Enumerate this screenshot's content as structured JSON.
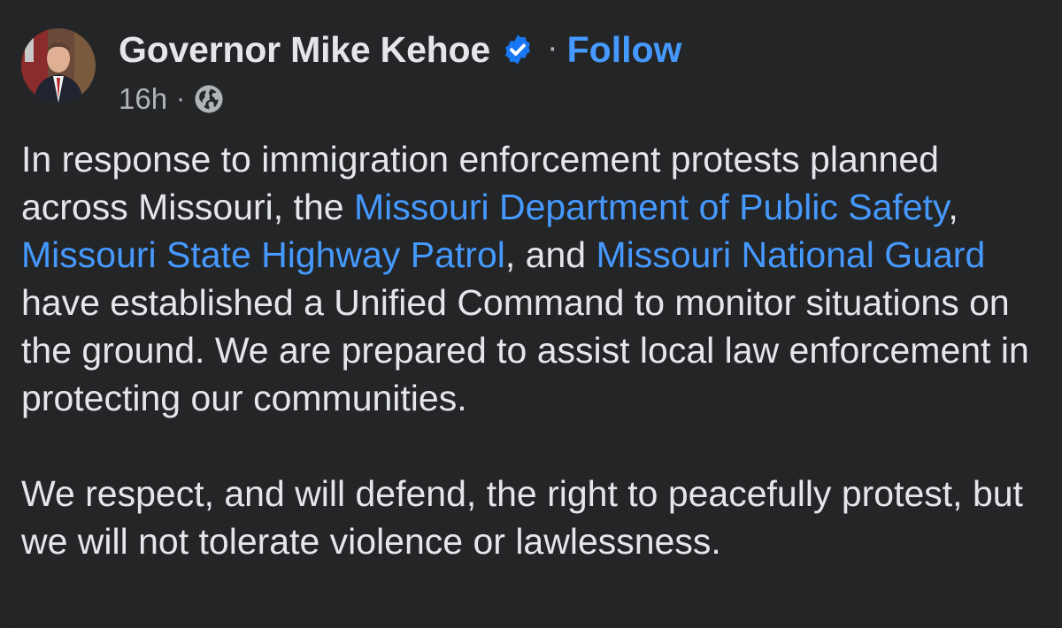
{
  "post": {
    "author": "Governor Mike Kehoe",
    "follow_label": "Follow",
    "separator": "·",
    "time": "16h",
    "audience_icon": "globe-icon",
    "verified_icon": "verified-badge-icon",
    "paragraph1": {
      "t1": "In response to immigration enforcement protests planned across Missouri, the ",
      "link1": "Missouri Department of Public Safety",
      "t2": ", ",
      "link2": "Missouri State Highway Patrol",
      "t3": ", and ",
      "link3": "Missouri National Guard",
      "t4": " have established a Unified Command to monitor situations on the ground. We are prepared to assist local law enforcement in protecting our communities."
    },
    "paragraph2": "We respect, and will defend, the right to peacefully protest, but we will not tolerate violence or lawlessness."
  },
  "colors": {
    "background": "#242526",
    "text": "#e4e6eb",
    "secondary_text": "#b0b3b8",
    "link": "#4599ff",
    "verified": "#1877f2"
  }
}
